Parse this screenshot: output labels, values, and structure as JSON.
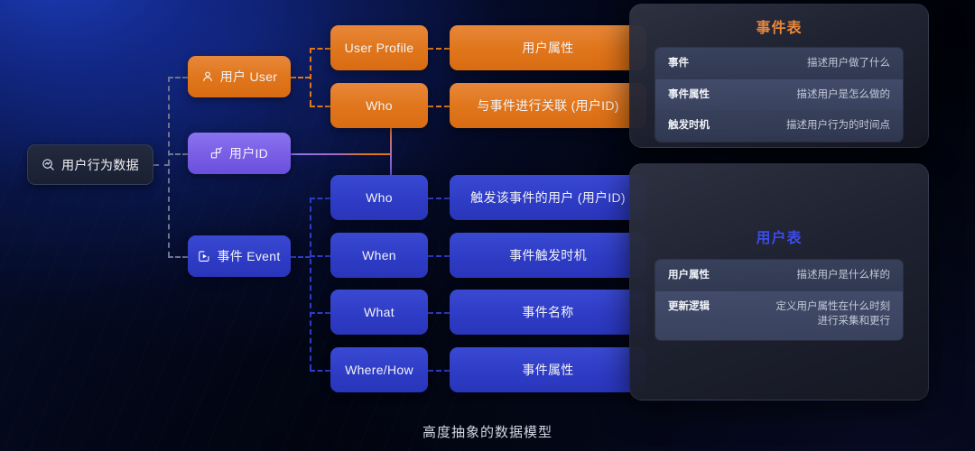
{
  "diagram": {
    "root": {
      "label": "用户行为数据",
      "icon": "search-analytics-icon"
    },
    "branches": {
      "user": {
        "label": "用户 User",
        "icon": "person-icon"
      },
      "user_id": {
        "label": "用户ID",
        "icon": "nodes-icon"
      },
      "event": {
        "label": "事件 Event",
        "icon": "play-square-icon"
      }
    },
    "user_items": [
      {
        "key": "User Profile",
        "value": "用户属性"
      },
      {
        "key": "Who",
        "value": "与事件进行关联 (用户ID)"
      }
    ],
    "event_items": [
      {
        "key": "Who",
        "value": "触发该事件的用户 (用户ID)"
      },
      {
        "key": "When",
        "value": "事件触发时机"
      },
      {
        "key": "What",
        "value": "事件名称"
      },
      {
        "key": "Where/How",
        "value": "事件属性"
      }
    ]
  },
  "panels": {
    "event_table": {
      "title": "事件表",
      "title_color": "#e8883c",
      "rows": [
        {
          "key": "事件",
          "value": "描述用户做了什么"
        },
        {
          "key": "事件属性",
          "value": "描述用户是怎么做的"
        },
        {
          "key": "触发时机",
          "value": "描述用户行为的时间点"
        }
      ]
    },
    "user_table": {
      "title": "用户表",
      "title_color": "#3b4ce8",
      "rows": [
        {
          "key": "用户属性",
          "value": "描述用户是什么样的"
        },
        {
          "key": "更新逻辑",
          "value": "定义用户属性在什么时刻\n进行采集和更行"
        }
      ]
    }
  },
  "caption": "高度抽象的数据模型",
  "colors": {
    "orange": "#e0761c",
    "purple": "#7a5fe6",
    "blue": "#2e3cc6",
    "dash_gray": "#6b7590"
  }
}
